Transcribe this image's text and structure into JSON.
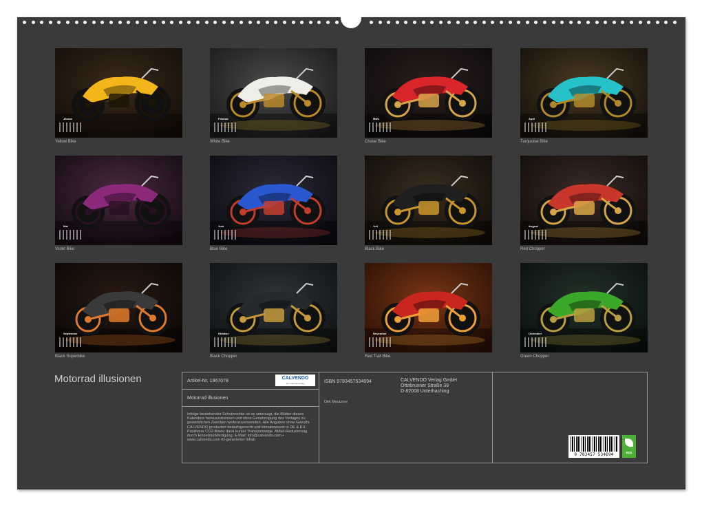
{
  "calendar_title": "Motorrad illusionen",
  "months": [
    {
      "label": "Januar",
      "caption": "Yellow Bike",
      "bg1": "#3a2a1a",
      "bg2": "#140d08",
      "accent": "#f2b61b",
      "dark": "#1d1406"
    },
    {
      "label": "Februar",
      "caption": "White Bike",
      "bg1": "#4a4a4a",
      "bg2": "#1a1a1a",
      "accent": "#f0eee8",
      "dark": "#b88a2a"
    },
    {
      "label": "März",
      "caption": "Cruise Bike",
      "bg1": "#2a1e1e",
      "bg2": "#0e0a0a",
      "accent": "#d8262b",
      "dark": "#d6a54a"
    },
    {
      "label": "April",
      "caption": "Turquoise Bike",
      "bg1": "#4a3a22",
      "bg2": "#15100a",
      "accent": "#27c2c9",
      "dark": "#b08a2a"
    },
    {
      "label": "Mai",
      "caption": "Violet Bike",
      "bg1": "#4a2a40",
      "bg2": "#140a12",
      "accent": "#8b2a7a",
      "dark": "#2a1024"
    },
    {
      "label": "Juni",
      "caption": "Blue Bike",
      "bg1": "#2b2a3a",
      "bg2": "#0c0b12",
      "accent": "#2a58d0",
      "dark": "#c43d2c"
    },
    {
      "label": "Juli",
      "caption": "Black Bike",
      "bg1": "#3a2d1f",
      "bg2": "#100c08",
      "accent": "#1f1f1f",
      "dark": "#c9962c"
    },
    {
      "label": "August",
      "caption": "Red Chopper",
      "bg1": "#3a2b24",
      "bg2": "#120c0a",
      "accent": "#c8362c",
      "dark": "#d7a648"
    },
    {
      "label": "September",
      "caption": "Black Superbike",
      "bg1": "#2a1a12",
      "bg2": "#0b0705",
      "accent": "#3a3a3a",
      "dark": "#e07a2a"
    },
    {
      "label": "Oktober",
      "caption": "Black Chopper",
      "bg1": "#2f3438",
      "bg2": "#0f1214",
      "accent": "#262a2e",
      "dark": "#c69a3c"
    },
    {
      "label": "November",
      "caption": "Red Trail Bike",
      "bg1": "#7a3614",
      "bg2": "#2a1006",
      "accent": "#c8261e",
      "dark": "#f0a038"
    },
    {
      "label": "Dezember",
      "caption": "Green Chopper",
      "bg1": "#22322a",
      "bg2": "#0a100c",
      "accent": "#3ca82a",
      "dark": "#b8a040"
    }
  ],
  "info": {
    "article_no": "Artikel-Nr. 1967078",
    "logo": "CALVENDO",
    "logo_sub": "Der Kalenderverlag",
    "title": "Motorrad illusionen",
    "legal": "Infolge bestehender Schutzrechte ist es untersagt, die Blätter dieses Kalenders herauszutrennen und ohne Genehmigung des Verlages zu gewerblichen Zwecken weiterzuverwenden. Alle Angaben ohne Gewähr. CALVENDO produziert bedarfsgerecht und klimabewusst in DE & EU. Positivere CO2-Bilanz dank kurzer Transportwege. Abfall-Reduzierung durch Einzelstückfertigung. E-Mail: info@calvendo.com • www.calvendo.com KI-generierter Inhalt",
    "isbn": "ISBN 9783457534694",
    "publisher_name": "CALVENDO Verlag GmbH",
    "publisher_street": "Ottobrunner Straße 39",
    "publisher_city": "D-82008 Unterhaching",
    "author": "Dirk Meutzner",
    "barcode_number": "9 783457 534694",
    "eco_label": "eco"
  }
}
